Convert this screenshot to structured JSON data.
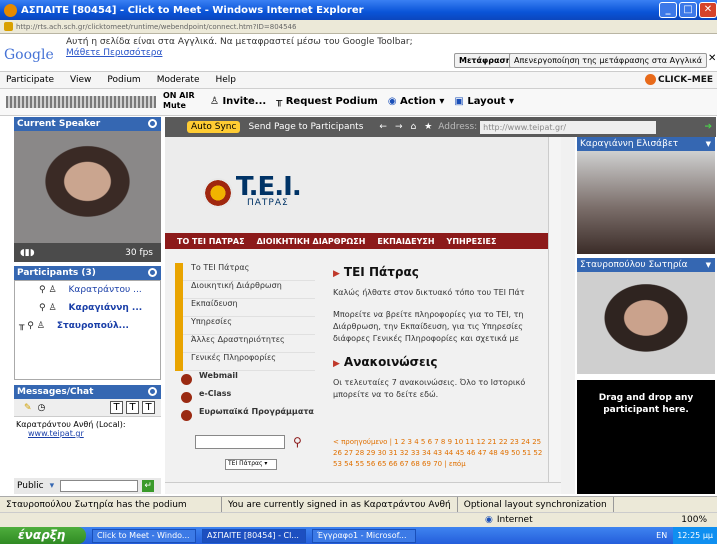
{
  "window": {
    "title": "ΑΣΠΑΙΤΕ [80454] - Click to Meet - Windows Internet Explorer",
    "url": "http://rts.ach.sch.gr/clicktomeet/runtime/webendpoint/connect.htm?ID=804546"
  },
  "google": {
    "logo": "Google",
    "toolbar": "Toolbar",
    "message": "Αυτή η σελίδα είναι στα Αγγλικά. Να μεταφραστεί μέσω του Google Toolbar;",
    "more": "Μάθετε Περισσότερα",
    "translate": "Μετάφραση",
    "disable": "Απενεργοποίηση της μετάφρασης στα Αγγλικά"
  },
  "menu": [
    "Participate",
    "View",
    "Podium",
    "Moderate",
    "Help"
  ],
  "brand": "CLICK–MEE",
  "toolbar": {
    "onair": "ON AIR",
    "mute": "Mute",
    "invite": "Invite...",
    "request": "Request Podium",
    "action": "Action",
    "layout": "Layout"
  },
  "current_speaker": {
    "title": "Current Speaker",
    "fps": "30 fps"
  },
  "participants": {
    "title": "Participants (3)",
    "list": [
      {
        "name": "Καρατράντου ..."
      },
      {
        "name": "Καραγιάννη ..."
      },
      {
        "name": "Σταυροπούλ..."
      }
    ]
  },
  "messages": {
    "title": "Messages/Chat",
    "from": "Καρατράντου Ανθή (Local):",
    "link": "www.teipat.gr",
    "public": "Public"
  },
  "content_toolbar": {
    "autosync": "Auto Sync",
    "send": "Send Page to Participants",
    "address_label": "Address:",
    "address": "http://www.teipat.gr/"
  },
  "web": {
    "logo": "T.E.I.",
    "logo_sub": "ΠΑΤΡΑΣ",
    "nav": [
      "ΤΟ ΤΕΙ ΠΑΤΡΑΣ",
      "ΔΙΟΙΚΗΤΙΚΗ ΔΙΑΡΘΡΩΣΗ",
      "ΕΚΠΑΙΔΕΥΣΗ",
      "ΥΠΗΡΕΣΙΕΣ"
    ],
    "side": [
      "Το ΤΕΙ Πάτρας",
      "Διοικητική Διάρθρωση",
      "Εκπαίδευση",
      "Υπηρεσίες",
      "Άλλες Δραστηριότητες",
      "Γενικές Πληροφορίες"
    ],
    "side_bold": [
      "Webmail",
      "e-Class",
      "Ευρωπαϊκά Προγράμματα"
    ],
    "select": "ΤΕΙ Πάτρας",
    "h1": "ΤΕΙ Πάτρας",
    "p1": "Καλώς ήλθατε στον δικτυακό τόπο του ΤΕΙ Πάτ",
    "p2": "Μπορείτε να βρείτε πληροφορίες για το ΤΕΙ, τη Διάρθρωση, την Εκπαίδευση, για τις Υπηρεσίες διάφορες Γενικές Πληροφορίες και σχετικά με",
    "h2": "Ανακοινώσεις",
    "p3": "Οι τελευταίες 7 ανακοινώσεις. Όλο το Ιστορικό μπορείτε να το δείτε εδώ.",
    "pager": "< προηγούμενο | 1 2 3 4 5 6 7 8 9 10 11 12 21 22 23 24 25 26 27 28 29 30 31 32 33 34 43 44 45 46 47 48 49 50 51 52 53 54 55 56 65 66 67 68 69 70 | επόμ"
  },
  "videos": [
    {
      "name": "Καραγιάννη Ελισάβετ"
    },
    {
      "name": "Σταυροπούλου Σωτηρία"
    }
  ],
  "drop": "Drag and drop any participant here.",
  "status": {
    "podium": "Σταυροπούλου Σωτηρία has the podium",
    "signed": "You are currently signed in as Καρατράντου Ανθή",
    "sync": "Optional layout synchronization"
  },
  "ie": {
    "zone": "Internet",
    "zoom": "100%"
  },
  "taskbar": {
    "start": "έναρξη",
    "tasks": [
      "Click to Meet - Windo...",
      "ΑΣΠΑΙΤΕ [80454] - Cl...",
      "Έγγραφο1 - Microsof..."
    ],
    "lang": "EN",
    "time": "12:25 μμ"
  }
}
